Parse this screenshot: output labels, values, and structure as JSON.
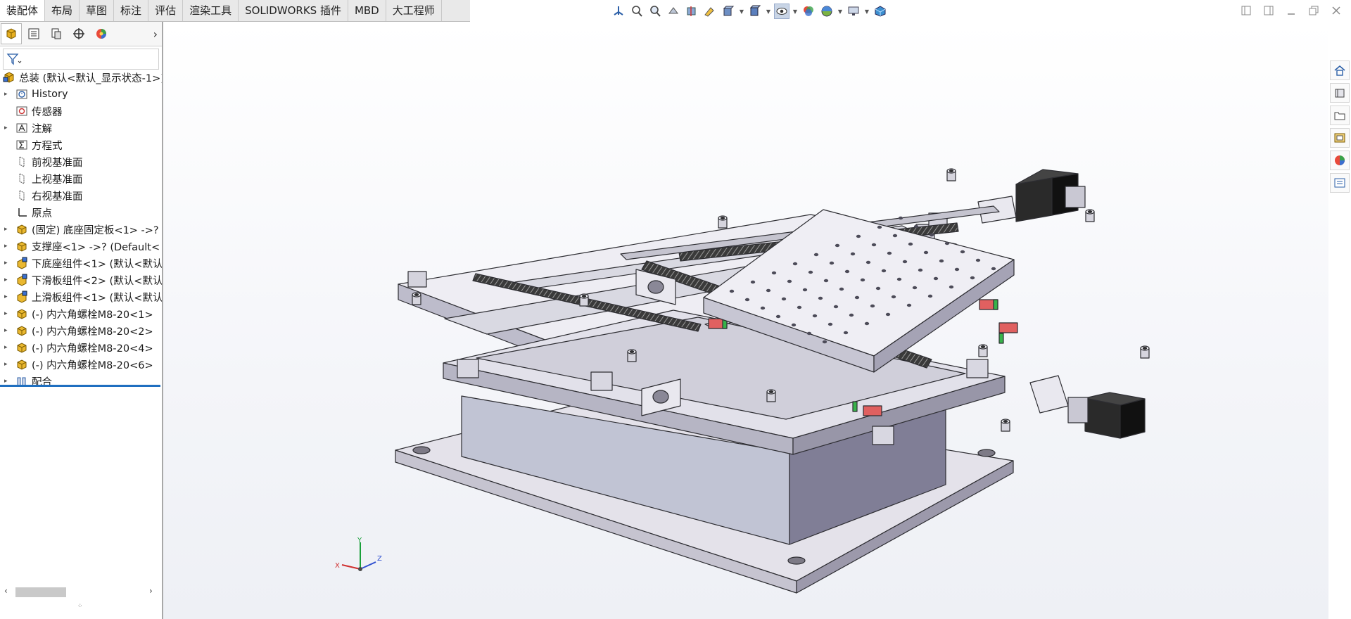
{
  "tabs": [
    {
      "label": "装配体",
      "active": true
    },
    {
      "label": "布局"
    },
    {
      "label": "草图"
    },
    {
      "label": "标注"
    },
    {
      "label": "评估"
    },
    {
      "label": "渲染工具"
    },
    {
      "label": "SOLIDWORKS 插件"
    },
    {
      "label": "MBD"
    },
    {
      "label": "大工程师"
    }
  ],
  "hud_icons": [
    "view-orientation-icon",
    "zoom-to-fit-icon",
    "zoom-area-icon",
    "previous-view-icon",
    "section-view-icon",
    "dynamic-annotation-icon",
    "view-orientation-dropdown-icon",
    "display-style-icon",
    "hide-show-items-icon",
    "edit-appearance-icon",
    "apply-scene-icon",
    "view-settings-icon",
    "display-icon"
  ],
  "feature_tree": {
    "root": "总装 (默认<默认_显示状态-1>)",
    "items": [
      {
        "label": "History",
        "icon": "history-icon",
        "expandable": true
      },
      {
        "label": "传感器",
        "icon": "sensor-icon",
        "expandable": false
      },
      {
        "label": "注解",
        "icon": "annotation-icon",
        "expandable": true
      },
      {
        "label": "方程式",
        "icon": "equation-icon",
        "expandable": false
      },
      {
        "label": "前视基准面",
        "icon": "plane-icon",
        "expandable": false
      },
      {
        "label": "上视基准面",
        "icon": "plane-icon",
        "expandable": false
      },
      {
        "label": "右视基准面",
        "icon": "plane-icon",
        "expandable": false
      },
      {
        "label": "原点",
        "icon": "origin-icon",
        "expandable": false
      },
      {
        "label": "(固定) 底座固定板<1> ->?",
        "icon": "part-icon",
        "expandable": true
      },
      {
        "label": "支撑座<1> ->? (Default<",
        "icon": "part-icon",
        "expandable": true
      },
      {
        "label": "下底座组件<1> (默认<默认",
        "icon": "subassembly-icon",
        "expandable": true
      },
      {
        "label": "下滑板组件<2> (默认<默认",
        "icon": "subassembly-icon",
        "expandable": true
      },
      {
        "label": "上滑板组件<1> (默认<默认",
        "icon": "subassembly-icon",
        "expandable": true
      },
      {
        "label": "(-) 内六角螺栓M8-20<1>",
        "icon": "part-icon",
        "expandable": true
      },
      {
        "label": "(-) 内六角螺栓M8-20<2>",
        "icon": "part-icon",
        "expandable": true
      },
      {
        "label": "(-) 内六角螺栓M8-20<4>",
        "icon": "part-icon",
        "expandable": true
      },
      {
        "label": "(-) 内六角螺栓M8-20<6>",
        "icon": "part-icon",
        "expandable": true
      },
      {
        "label": "配合",
        "icon": "mates-icon",
        "expandable": true
      }
    ]
  },
  "task_pane": [
    "home-icon",
    "design-library-icon",
    "file-explorer-icon",
    "view-palette-icon",
    "appearances-icon",
    "custom-properties-icon"
  ],
  "triad": {
    "x": "X",
    "y": "Y",
    "z": "Z"
  },
  "colors": {
    "accent": "#1f6fc0",
    "part": "#e8b020",
    "steel": "#d4d4dc",
    "motor": "#1e1e1e"
  }
}
